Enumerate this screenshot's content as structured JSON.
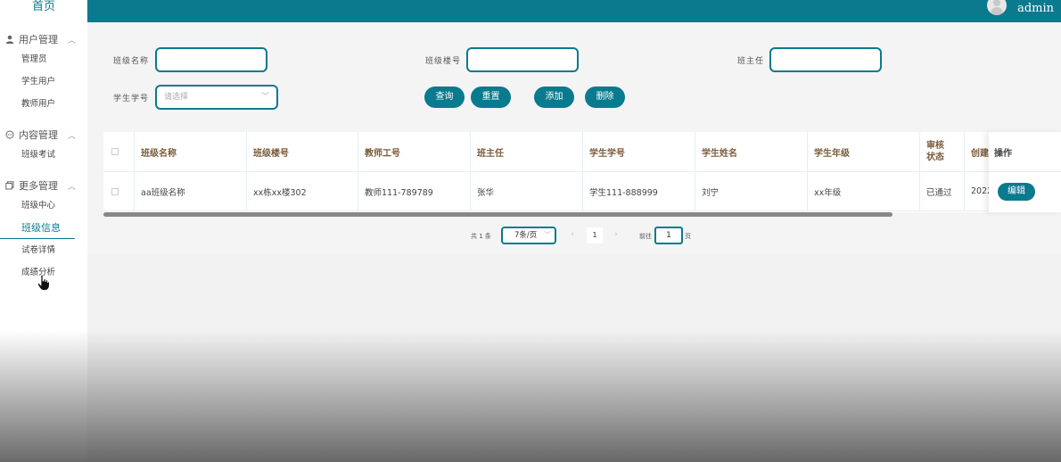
{
  "sidebar": {
    "home": "首页",
    "groups": [
      {
        "title": "用户管理",
        "icon": "user-icon",
        "items": [
          "管理员",
          "学生用户",
          "教师用户"
        ]
      },
      {
        "title": "内容管理",
        "icon": "chat-icon",
        "items": [
          "班级考试"
        ]
      },
      {
        "title": "更多管理",
        "icon": "copy-icon",
        "items": [
          "班级中心",
          "班级信息",
          "试卷详情",
          "成绩分析"
        ]
      }
    ],
    "active_item": "班级信息"
  },
  "header": {
    "user_name": "admin",
    "accent": "#0a7a8f"
  },
  "search": {
    "class_name_label": "班级名称",
    "class_name_value": "",
    "building_label": "班级楼号",
    "building_value": "",
    "teacher_label": "班主任",
    "teacher_value": "",
    "student_no_label": "学生学号",
    "student_no_placeholder": "请选择"
  },
  "buttons": {
    "query": "查询",
    "reset": "重置",
    "add": "添加",
    "delete": "删除"
  },
  "table": {
    "headers": [
      "班级名称",
      "班级楼号",
      "教师工号",
      "班主任",
      "学生学号",
      "学生姓名",
      "学生年级",
      "审核状态",
      "创建"
    ],
    "operation_header": "操作",
    "rows": [
      [
        "aa班级名称",
        "xx栋xx楼302",
        "教师111-789789",
        "张华",
        "学生111-888999",
        "刘宁",
        "xx年级",
        "已通过",
        "2022"
      ]
    ],
    "edit_label": "编辑"
  },
  "pagination": {
    "total_text": "共 1 条",
    "page_size": "7条/页",
    "current_page": "1",
    "goto_label": "前往",
    "goto_value": "1",
    "page_suffix": "页"
  }
}
